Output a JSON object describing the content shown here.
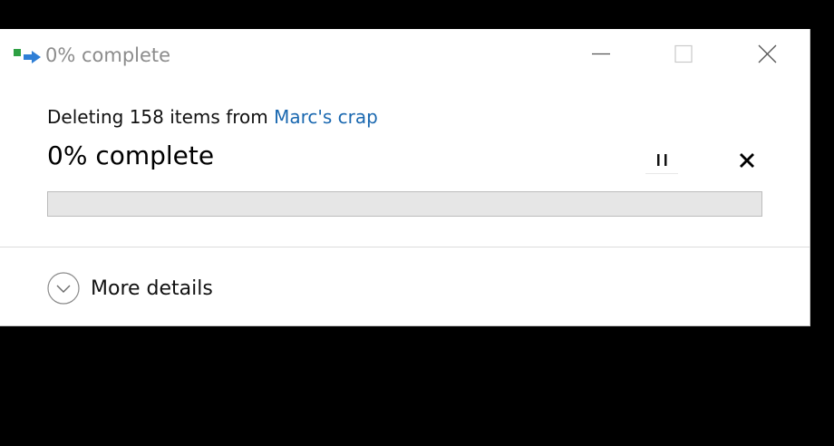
{
  "window": {
    "title": "0% complete",
    "icon": "file-operation-icon",
    "controls": [
      "minimize-icon",
      "maximize-icon",
      "close-icon"
    ]
  },
  "operation": {
    "prefix": "Deleting 158 items from ",
    "source_link": "Marc's crap",
    "progress_text": "0% complete",
    "progress_value": 0,
    "progress_color": "#06b025",
    "link_color": "#1a68b0"
  },
  "details": {
    "label": "More details",
    "icon": "chevron-down-circle-icon"
  }
}
